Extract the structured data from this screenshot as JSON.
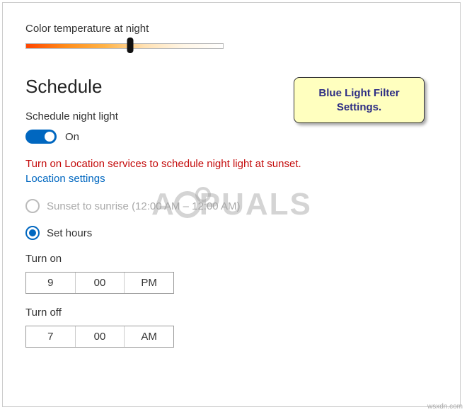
{
  "colorTemp": {
    "label": "Color temperature at night"
  },
  "schedule": {
    "heading": "Schedule",
    "toggleLabel": "Schedule night light",
    "toggleState": "On",
    "warning": "Turn on Location services to schedule night light at sunset.",
    "link": "Location settings",
    "radioSunset": "Sunset to sunrise (12:00 AM – 12:00 AM)",
    "radioSetHours": "Set hours"
  },
  "turnOn": {
    "label": "Turn on",
    "hour": "9",
    "minute": "00",
    "ampm": "PM"
  },
  "turnOff": {
    "label": "Turn off",
    "hour": "7",
    "minute": "00",
    "ampm": "AM"
  },
  "callout": {
    "line1": "Blue Light Filter",
    "line2": "Settings."
  },
  "watermark": {
    "left": "A",
    "right": "PUALS"
  },
  "source": "wsxdn.com"
}
